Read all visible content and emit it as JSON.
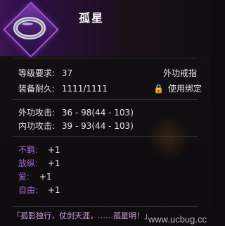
{
  "item": {
    "name": "孤星",
    "icon": "ring-icon"
  },
  "stats": {
    "level_label": "等级要求:",
    "level_value": "37",
    "type": "外功戒指",
    "durability_label": "装备耐久:",
    "durability_value": "1111/1111",
    "bind_icon": "lock-icon",
    "bind_text": "使用绑定"
  },
  "attack": {
    "outer_label": "外功攻击:",
    "outer_value": "36 - 98(44 - 103)",
    "inner_label": "内功攻击:",
    "inner_value": "39 - 93(44 - 103)"
  },
  "attributes": [
    {
      "name": "不羁:",
      "value": "+1"
    },
    {
      "name": "放纵:",
      "value": "+1"
    },
    {
      "name": "爱:",
      "value": "+1"
    },
    {
      "name": "自由:",
      "value": "+1"
    }
  ],
  "description": "「孤影独行，仗剑天涯，……孤星明！」",
  "watermark": "www.ucbug.cc",
  "colors": {
    "accent": "#7a3aa8",
    "attribute": "#a86ad8",
    "bind_lock": "#e8a030"
  }
}
